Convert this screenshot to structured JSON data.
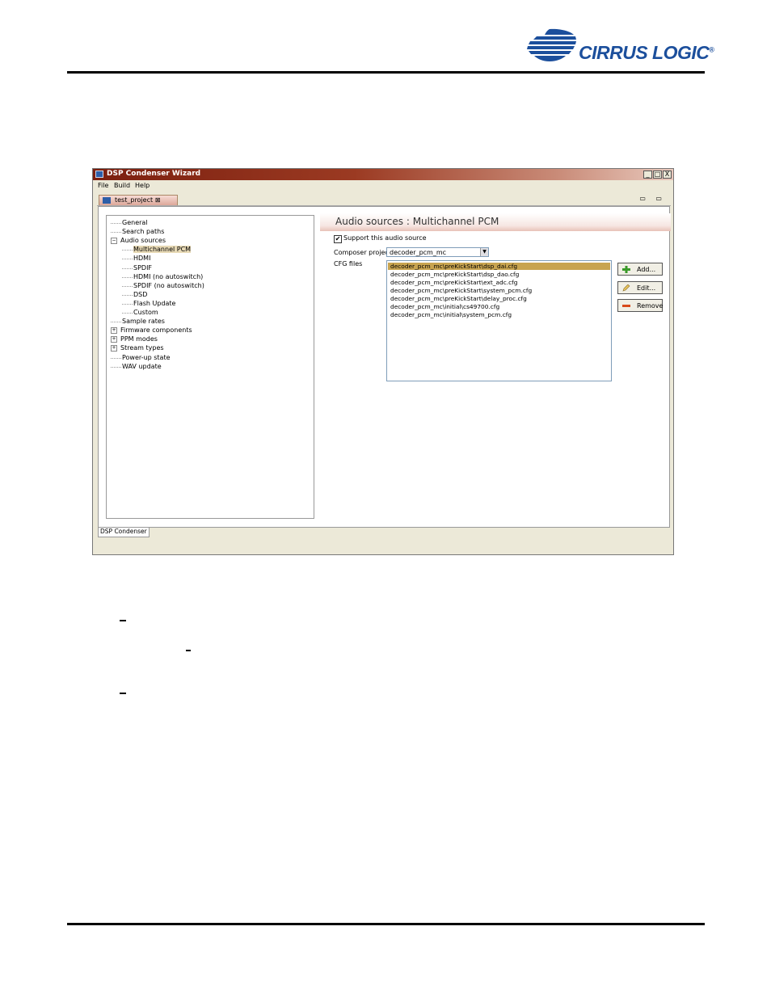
{
  "header": {
    "logo_text": "CIRRUS LOGIC",
    "logo_mark": "®"
  },
  "window": {
    "title": "DSP Condenser Wizard",
    "controls": [
      "_",
      "□",
      "X"
    ],
    "menus": [
      "File",
      "Build",
      "Help"
    ],
    "editor_tab": "test_project",
    "editor_tab_suffix": "⊠",
    "tab_controls": "▭ ▭",
    "bottom_tab": "DSP Condenser"
  },
  "tree": {
    "items": [
      {
        "label": "General",
        "level": 1,
        "expander": ""
      },
      {
        "label": "Search paths",
        "level": 1,
        "expander": ""
      },
      {
        "label": "Audio sources",
        "level": 1,
        "expander": "−"
      },
      {
        "label": "Multichannel PCM",
        "level": 2,
        "expander": "",
        "selected": true
      },
      {
        "label": "HDMI",
        "level": 2,
        "expander": ""
      },
      {
        "label": "SPDIF",
        "level": 2,
        "expander": ""
      },
      {
        "label": "HDMI (no autoswitch)",
        "level": 2,
        "expander": ""
      },
      {
        "label": "SPDIF (no autoswitch)",
        "level": 2,
        "expander": ""
      },
      {
        "label": "DSD",
        "level": 2,
        "expander": ""
      },
      {
        "label": "Flash Update",
        "level": 2,
        "expander": ""
      },
      {
        "label": "Custom",
        "level": 2,
        "expander": ""
      },
      {
        "label": "Sample rates",
        "level": 1,
        "expander": ""
      },
      {
        "label": "Firmware components",
        "level": 1,
        "expander": "+"
      },
      {
        "label": "PPM modes",
        "level": 1,
        "expander": "+"
      },
      {
        "label": "Stream types",
        "level": 1,
        "expander": "+"
      },
      {
        "label": "Power-up state",
        "level": 1,
        "expander": ""
      },
      {
        "label": "WAV update",
        "level": 1,
        "expander": ""
      }
    ]
  },
  "page": {
    "title": "Audio sources : Multichannel PCM",
    "support_checkbox": {
      "label": "Support this audio source",
      "checked": "✔"
    },
    "composer": {
      "label": "Composer project",
      "value": "decoder_pcm_mc",
      "arrow": "▼"
    },
    "cfg_label": "CFG files",
    "cfg_files": [
      "decoder_pcm_mc\\preKickStart\\dsp_dai.cfg",
      "decoder_pcm_mc\\preKickStart\\dsp_dao.cfg",
      "decoder_pcm_mc\\preKickStart\\ext_adc.cfg",
      "decoder_pcm_mc\\preKickStart\\system_pcm.cfg",
      "decoder_pcm_mc\\preKickStart\\delay_proc.cfg",
      "decoder_pcm_mc\\initial\\cs49700.cfg",
      "decoder_pcm_mc\\initial\\system_pcm.cfg"
    ],
    "buttons": {
      "add": "Add...",
      "edit": "Edit...",
      "remove": "Remove"
    }
  }
}
